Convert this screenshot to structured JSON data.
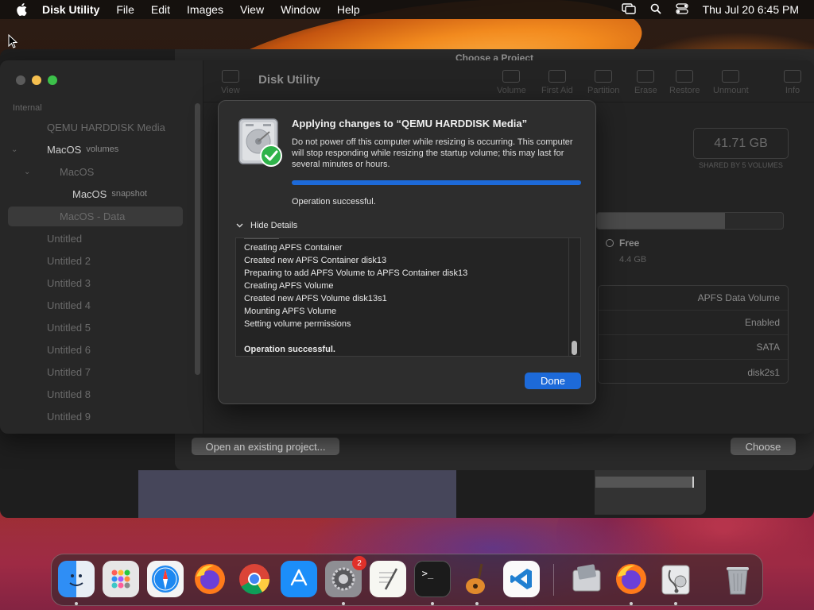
{
  "menubar": {
    "app_name": "Disk Utility",
    "items": [
      "File",
      "Edit",
      "Images",
      "View",
      "Window",
      "Help"
    ],
    "clock": "Thu Jul 20  6:45 PM"
  },
  "project_window": {
    "title": "Choose a Project",
    "open_button": "Open an existing project...",
    "choose_button": "Choose"
  },
  "disk_utility": {
    "title": "Disk Utility",
    "sidebar": {
      "section": "Internal",
      "items": [
        {
          "label": "QEMU HARDDISK Media",
          "sub": ""
        },
        {
          "label": "MacOS",
          "sub": "volumes"
        },
        {
          "label": "MacOS",
          "sub": ""
        },
        {
          "label": "MacOS",
          "sub": "snapshot"
        },
        {
          "label": "MacOS - Data",
          "sub": ""
        },
        {
          "label": "Untitled",
          "sub": ""
        },
        {
          "label": "Untitled 2",
          "sub": ""
        },
        {
          "label": "Untitled 3",
          "sub": ""
        },
        {
          "label": "Untitled 4",
          "sub": ""
        },
        {
          "label": "Untitled 5",
          "sub": ""
        },
        {
          "label": "Untitled 6",
          "sub": ""
        },
        {
          "label": "Untitled 7",
          "sub": ""
        },
        {
          "label": "Untitled 8",
          "sub": ""
        },
        {
          "label": "Untitled 9",
          "sub": ""
        }
      ]
    },
    "toolbar": {
      "view": "View",
      "volume": "Volume",
      "first_aid": "First Aid",
      "partition": "Partition",
      "erase": "Erase",
      "restore": "Restore",
      "unmount": "Unmount",
      "info": "Info"
    },
    "capacity": "41.71 GB",
    "capacity_sub": "SHARED BY 5 VOLUMES",
    "usage_fraction": 0.69,
    "free_label": "Free",
    "free_size": "4.4 GB",
    "info_rows": [
      "APFS Data Volume",
      "Enabled",
      "SATA",
      "disk2s1"
    ]
  },
  "sheet": {
    "title": "Applying changes to “QEMU HARDDISK Media”",
    "message": "Do not power off this computer while resizing is occurring. This computer will stop responding while resizing the startup volume; this may last for several minutes or hours.",
    "progress": 1.0,
    "status": "Operation successful.",
    "details_toggle": "Hide Details",
    "log": [
      "Creating APFS Container",
      "Created new APFS Container disk13",
      "Preparing to add APFS Volume to APFS Container disk13",
      "Creating APFS Volume",
      "Created new APFS Volume disk13s1",
      "Mounting APFS Volume",
      "Setting volume permissions",
      "",
      "Operation successful."
    ],
    "done_button": "Done"
  },
  "dock": {
    "items": [
      "finder-icon",
      "launchpad-icon",
      "safari-icon",
      "firefox-icon",
      "chrome-icon",
      "app-store-icon",
      "system-preferences-icon",
      "textedit-icon",
      "terminal-icon",
      "garageband-icon",
      "vscode-icon",
      "boot-camp-icon",
      "firefox-icon",
      "disk-utility-icon",
      "trash-icon"
    ],
    "badge_count": "2"
  },
  "colors": {
    "accent": "#1d6ad9",
    "success": "#2fb34a"
  }
}
